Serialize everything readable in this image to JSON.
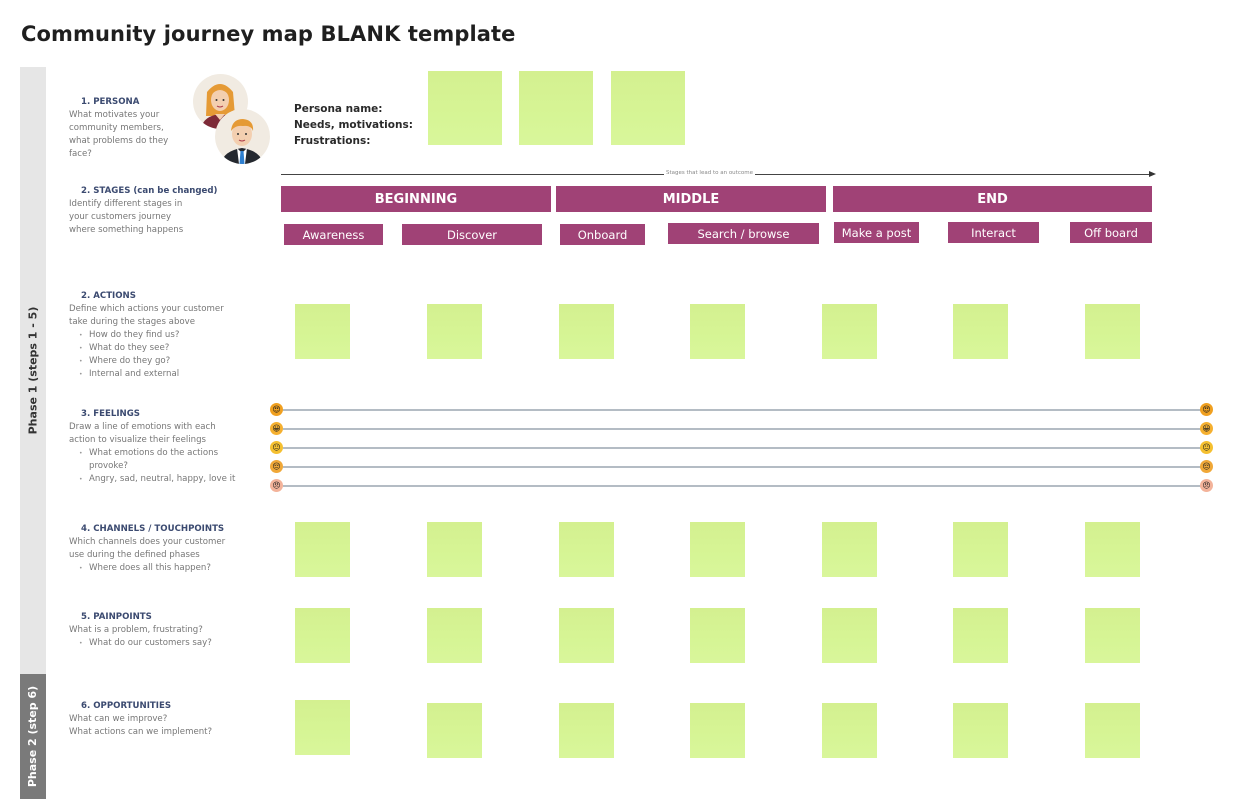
{
  "title": "Community journey map BLANK template",
  "phases": [
    {
      "label": "Phase 1 (steps 1 - 5)"
    },
    {
      "label": "Phase 2 (step 6)"
    }
  ],
  "sections": {
    "persona": {
      "heading": "1. PERSONA",
      "lines": [
        "What motivates your",
        "community members,",
        "what problems do they",
        "face?"
      ],
      "bullets": []
    },
    "stages": {
      "heading": "2. STAGES (can be changed)",
      "lines": [
        "Identify different stages in",
        "your customers journey",
        "where something happens"
      ],
      "bullets": []
    },
    "actions": {
      "heading": "2. ACTIONS",
      "lines": [
        "Define which actions your customer",
        "take during the stages above"
      ],
      "bullets": [
        "How do they find us?",
        "What do they see?",
        "Where do they go?",
        "Internal and external"
      ]
    },
    "feelings": {
      "heading": "3. FEELINGS",
      "lines": [
        "Draw a line of emotions with each",
        "action to visualize their feelings"
      ],
      "bullets": [
        "What emotions do the actions provoke?",
        "Angry, sad, neutral, happy, love it"
      ]
    },
    "channels": {
      "heading": "4. CHANNELS / TOUCHPOINTS",
      "lines": [
        "Which channels does your customer",
        "use during the defined phases"
      ],
      "bullets": [
        "Where does all this happen?"
      ]
    },
    "painpoints": {
      "heading": "5. PAINPOINTS",
      "lines": [
        "What is a problem, frustrating?"
      ],
      "bullets": [
        "What do our customers say?"
      ]
    },
    "opportunities": {
      "heading": "6. OPPORTUNITIES",
      "lines": [
        "What can we improve?",
        "What actions can we implement?"
      ],
      "bullets": []
    }
  },
  "persona_fields": {
    "name_label": "Persona name:",
    "needs_label": "Needs, motivations:",
    "frustrations_label": "Frustrations:"
  },
  "avatars": [
    {
      "icon": "female-persona-avatar"
    },
    {
      "icon": "male-persona-avatar"
    }
  ],
  "timeline": {
    "label": "Stages that lead to an outcome"
  },
  "stages": [
    {
      "label": "BEGINNING",
      "substages": [
        "Awareness",
        "Discover"
      ]
    },
    {
      "label": "MIDDLE",
      "substages": [
        "Onboard",
        "Search / browse"
      ]
    },
    {
      "label": "END",
      "substages": [
        "Make a post",
        "Interact",
        "Off board"
      ]
    }
  ],
  "substages": [
    "Awareness",
    "Discover",
    "Onboard",
    "Search / browse",
    "Make a post",
    "Interact",
    "Off board"
  ],
  "feelings_scale": [
    {
      "name": "love-it",
      "glyph": "😍",
      "color": "#f0a020"
    },
    {
      "name": "happy",
      "glyph": "😀",
      "color": "#f5b030"
    },
    {
      "name": "neutral",
      "glyph": "😐",
      "color": "#f5c030"
    },
    {
      "name": "sad",
      "glyph": "😔",
      "color": "#f0a838"
    },
    {
      "name": "angry",
      "glyph": "😠",
      "color": "#f3b39a"
    }
  ],
  "sticky_rows": {
    "persona": 3,
    "actions": 7,
    "channels": 7,
    "painpoints": 7,
    "opportunities": 7
  },
  "colors": {
    "stage_bar": "#a04276",
    "sticky": "#d6f595",
    "heading": "#3b4a70",
    "phase1_bar": "#e6e6e6",
    "phase2_bar": "#7a7a7a"
  }
}
